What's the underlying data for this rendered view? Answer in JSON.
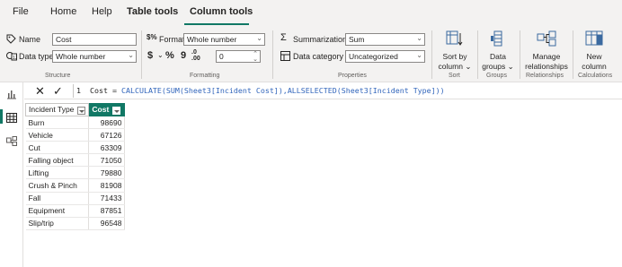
{
  "tabs": [
    {
      "label": "File"
    },
    {
      "label": "Home"
    },
    {
      "label": "Help"
    },
    {
      "label": "Table tools"
    },
    {
      "label": "Column tools"
    }
  ],
  "ribbon": {
    "structure": {
      "name_label": "Name",
      "name_value": "Cost",
      "datatype_label": "Data type",
      "datatype_value": "Whole number",
      "group_label": "Structure"
    },
    "formatting": {
      "format_label": "Format",
      "format_value": "Whole number",
      "currency_symbol": "$",
      "percent_symbol": "%",
      "comma_symbol": "9",
      "decimals_value": "0",
      "group_label": "Formatting"
    },
    "properties": {
      "summarization_label": "Summarization",
      "summarization_value": "Sum",
      "category_label": "Data category",
      "category_value": "Uncategorized",
      "group_label": "Properties"
    },
    "sort": {
      "button_line1": "Sort by",
      "button_line2": "column",
      "group_label": "Sort"
    },
    "groups": {
      "button_line1": "Data",
      "button_line2": "groups",
      "group_label": "Groups"
    },
    "relationships": {
      "button_line1": "Manage",
      "button_line2": "relationships",
      "group_label": "Relationships"
    },
    "calculations": {
      "button_line1": "New",
      "button_line2": "column",
      "group_label": "Calculations"
    }
  },
  "formula_bar": {
    "cancel_icon": "close-icon",
    "commit_icon": "check-icon",
    "line_number": "1",
    "formula_prefix": "Cost = ",
    "formula_fn1": "CALCULATE(",
    "formula_fn2": "SUM(",
    "formula_arg1": "Sheet3[Incident Cost]",
    "formula_mid": "),",
    "formula_fn3": "ALLSELECTED(",
    "formula_arg2": "Sheet3[Incident Type]",
    "formula_end": "))"
  },
  "table": {
    "columns": [
      "Incident Type",
      "Cost"
    ],
    "rows": [
      {
        "type": "Burn",
        "cost": "98690"
      },
      {
        "type": "Vehicle",
        "cost": "67126"
      },
      {
        "type": "Cut",
        "cost": "63309"
      },
      {
        "type": "Falling object",
        "cost": "71050"
      },
      {
        "type": "Lifting",
        "cost": "79880"
      },
      {
        "type": "Crush & Pinch",
        "cost": "81908"
      },
      {
        "type": "Fall",
        "cost": "71433"
      },
      {
        "type": "Equipment",
        "cost": "87851"
      },
      {
        "type": "Slip/trip",
        "cost": "96548"
      }
    ]
  },
  "colors": {
    "accent": "#117865",
    "ribbon_bg": "#f3f2f1",
    "formula_fn": "#3165bb"
  }
}
